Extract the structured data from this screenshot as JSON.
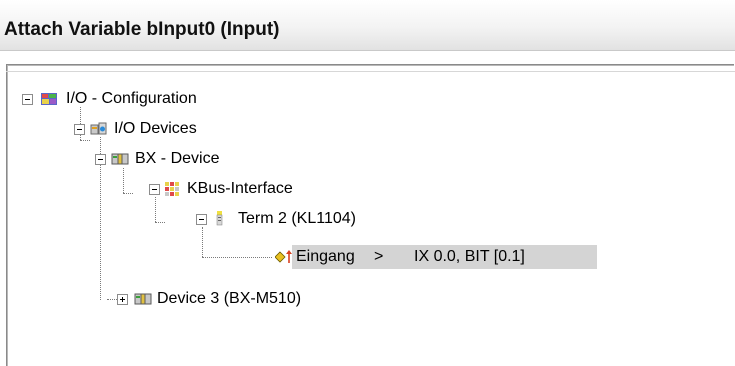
{
  "window": {
    "title": "Attach Variable bInput0 (Input)"
  },
  "tree": {
    "root": {
      "label": "I/O - Configuration",
      "icon": "io-configuration-icon",
      "expanded": true
    },
    "io_devices": {
      "label": "I/O Devices",
      "icon": "io-devices-icon",
      "expanded": true
    },
    "bx_device": {
      "label": "BX - Device",
      "icon": "device-icon",
      "expanded": true
    },
    "kbus_interface": {
      "label": "KBus-Interface",
      "icon": "kbus-interface-icon",
      "expanded": true
    },
    "term2": {
      "label": "Term 2 (KL1104)",
      "icon": "terminal-icon",
      "expanded": true
    },
    "eingang": {
      "name": "Eingang",
      "separator": ">",
      "address": "IX 0.0, BIT [0.1]",
      "icon": "input-variable-icon",
      "selected": true
    },
    "device3": {
      "label": "Device 3 (BX-M510)",
      "icon": "device-icon",
      "expanded": false
    }
  },
  "colors": {
    "selection": "#d4d4d4",
    "tree_lines": "#7a7a7a"
  }
}
